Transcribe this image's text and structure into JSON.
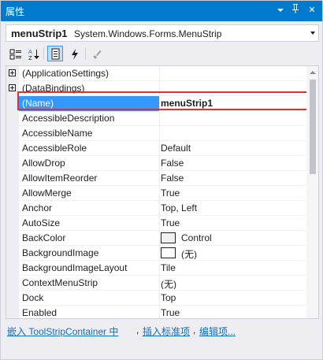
{
  "window": {
    "title": "属性",
    "dropdown_glyph": "▼",
    "pin_glyph": "ᛘ",
    "close_glyph": "✕"
  },
  "object_selector": {
    "name": "menuStrip1",
    "type": "System.Windows.Forms.MenuStrip"
  },
  "toolbar": {
    "buttons": [
      "categorized-icon",
      "alphabetical-icon",
      "properties-icon",
      "events-icon",
      "property-pages-icon"
    ],
    "active": "properties-icon"
  },
  "properties": [
    {
      "name": "(ApplicationSettings)",
      "value": "",
      "expandable": true
    },
    {
      "name": "(DataBindings)",
      "value": "",
      "expandable": true
    },
    {
      "name": "(Name)",
      "value": "menuStrip1",
      "selected": true
    },
    {
      "name": "AccessibleDescription",
      "value": ""
    },
    {
      "name": "AccessibleName",
      "value": ""
    },
    {
      "name": "AccessibleRole",
      "value": "Default"
    },
    {
      "name": "AllowDrop",
      "value": "False"
    },
    {
      "name": "AllowItemReorder",
      "value": "False"
    },
    {
      "name": "AllowMerge",
      "value": "True"
    },
    {
      "name": "Anchor",
      "value": "Top, Left"
    },
    {
      "name": "AutoSize",
      "value": "True"
    },
    {
      "name": "BackColor",
      "value": "Control",
      "swatch": "#f0f0f0"
    },
    {
      "name": "BackgroundImage",
      "value": "(无)",
      "swatch": "#ffffff"
    },
    {
      "name": "BackgroundImageLayout",
      "value": "Tile"
    },
    {
      "name": "ContextMenuStrip",
      "value": "(无)"
    },
    {
      "name": "Dock",
      "value": "Top"
    },
    {
      "name": "Enabled",
      "value": "True"
    }
  ],
  "commands": {
    "link1": "嵌入 ToolStripContainer 中",
    "sep1": ",",
    "link2": "插入标准项",
    "sep2": ",",
    "link3": "编辑项..."
  },
  "colors": {
    "titlebar": "#007acc",
    "selection": "#3399ff",
    "highlight": "#e03030",
    "link": "#0e70c0"
  }
}
